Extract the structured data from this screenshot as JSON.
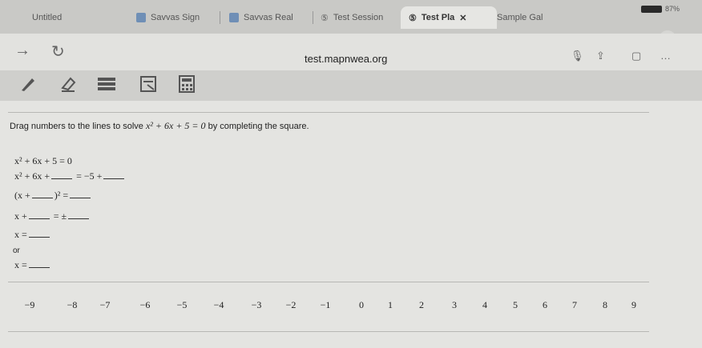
{
  "browser": {
    "tabs": [
      {
        "label": "Untitled"
      },
      {
        "label": "Savvas Sign"
      },
      {
        "label": "Savvas Real"
      },
      {
        "label": "Test Session"
      },
      {
        "label": "Test Pla"
      },
      {
        "label": "Sample Gal"
      }
    ],
    "status_battery": "87%",
    "url": "test.mapnwea.org"
  },
  "question": {
    "prompt": "Drag numbers to the lines to solve",
    "equation": "x² + 6x + 5 = 0",
    "prompt_suffix": "by completing the square.",
    "steps": {
      "s1": "x² + 6x + 5 = 0",
      "s2a": "x² + 6x +",
      "s2b": "= −5 +",
      "s3a": "(x +",
      "s3b": ")² =",
      "s4a": "x +",
      "s4b": "= ±",
      "s5a": "x =",
      "or": "or",
      "s6a": "x ="
    }
  },
  "number_bank": [
    "−9",
    "−8",
    "−7",
    "−6",
    "−5",
    "−4",
    "−3",
    "−2",
    "−1",
    "0",
    "1",
    "2",
    "3",
    "4",
    "5",
    "6",
    "7",
    "8",
    "9"
  ]
}
